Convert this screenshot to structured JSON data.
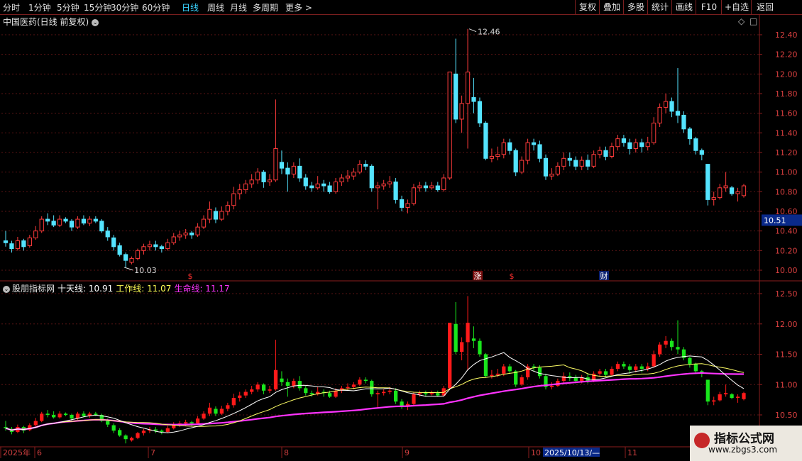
{
  "toolbar": {
    "period_tabs": [
      "分时",
      "1分钟",
      "5分钟",
      "15分钟",
      "30分钟",
      "60分钟",
      "日线",
      "周线",
      "月线",
      "多周期",
      "更多 >"
    ],
    "active_tab": "日线",
    "right_buttons": [
      "复权",
      "叠加",
      "多股",
      "统计",
      "画线",
      "F10",
      "+自选",
      "返回"
    ]
  },
  "main_chart": {
    "title": "中国医药(日线 前复权)",
    "price_ticks": [
      "12.40",
      "12.20",
      "12.00",
      "11.80",
      "11.60",
      "11.40",
      "11.20",
      "11.00",
      "10.80",
      "10.60",
      "10.40",
      "10.20",
      "10.00"
    ],
    "current_price": "10.51",
    "high_label": "12.46",
    "low_label": "10.03",
    "markers": [
      "$",
      "涨",
      "$",
      "财"
    ]
  },
  "sub_chart": {
    "name": "股朋指标网",
    "line1_label": "十天线: 10.91",
    "line2_label": "工作线: 11.07",
    "line3_label": "生命线: 11.17",
    "ticks": [
      "12.50",
      "12.00",
      "11.50",
      "11.00",
      "10.50"
    ]
  },
  "x_axis": {
    "labels": [
      "2025年",
      "6",
      "7",
      "8",
      "9",
      "10",
      "11"
    ],
    "cursor_date": "2025/10/13/—"
  },
  "watermark": {
    "title": "指标公式网",
    "url": "www.zbgs3.com"
  },
  "colors": {
    "up": "#ff3b3b",
    "down": "#54e4ff",
    "sub_up": "#ff1a1a",
    "sub_down": "#19e61c",
    "ma_white": "#ffffff",
    "ma_yellow": "#ffff66",
    "ma_magenta": "#ff33ff"
  },
  "chart_data": {
    "type": "candlestick",
    "title": "中国医药(日线 前复权)",
    "ylim": [
      9.95,
      12.5
    ],
    "x_months": [
      "2025年",
      "6",
      "7",
      "8",
      "9",
      "10",
      "11"
    ],
    "candles": [
      {
        "o": 10.3,
        "c": 10.28,
        "h": 10.4,
        "l": 10.24
      },
      {
        "o": 10.27,
        "c": 10.22,
        "h": 10.3,
        "l": 10.18
      },
      {
        "o": 10.22,
        "c": 10.3,
        "h": 10.34,
        "l": 10.2
      },
      {
        "o": 10.3,
        "c": 10.24,
        "h": 10.32,
        "l": 10.2
      },
      {
        "o": 10.25,
        "c": 10.33,
        "h": 10.36,
        "l": 10.23
      },
      {
        "o": 10.33,
        "c": 10.4,
        "h": 10.45,
        "l": 10.31
      },
      {
        "o": 10.4,
        "c": 10.52,
        "h": 10.55,
        "l": 10.38
      },
      {
        "o": 10.52,
        "c": 10.5,
        "h": 10.58,
        "l": 10.46
      },
      {
        "o": 10.5,
        "c": 10.46,
        "h": 10.56,
        "l": 10.44
      },
      {
        "o": 10.46,
        "c": 10.52,
        "h": 10.56,
        "l": 10.44
      },
      {
        "o": 10.52,
        "c": 10.5,
        "h": 10.54,
        "l": 10.48
      },
      {
        "o": 10.5,
        "c": 10.44,
        "h": 10.52,
        "l": 10.4
      },
      {
        "o": 10.44,
        "c": 10.52,
        "h": 10.55,
        "l": 10.42
      },
      {
        "o": 10.52,
        "c": 10.48,
        "h": 10.56,
        "l": 10.46
      },
      {
        "o": 10.48,
        "c": 10.52,
        "h": 10.55,
        "l": 10.45
      },
      {
        "o": 10.52,
        "c": 10.5,
        "h": 10.55,
        "l": 10.48
      },
      {
        "o": 10.5,
        "c": 10.4,
        "h": 10.52,
        "l": 10.38
      },
      {
        "o": 10.4,
        "c": 10.34,
        "h": 10.44,
        "l": 10.3
      },
      {
        "o": 10.33,
        "c": 10.24,
        "h": 10.36,
        "l": 10.2
      },
      {
        "o": 10.25,
        "c": 10.16,
        "h": 10.28,
        "l": 10.14
      },
      {
        "o": 10.16,
        "c": 10.1,
        "h": 10.18,
        "l": 10.03
      },
      {
        "o": 10.08,
        "c": 10.12,
        "h": 10.14,
        "l": 10.06
      },
      {
        "o": 10.12,
        "c": 10.2,
        "h": 10.22,
        "l": 10.1
      },
      {
        "o": 10.2,
        "c": 10.24,
        "h": 10.27,
        "l": 10.16
      },
      {
        "o": 10.24,
        "c": 10.26,
        "h": 10.3,
        "l": 10.2
      },
      {
        "o": 10.26,
        "c": 10.24,
        "h": 10.3,
        "l": 10.2
      },
      {
        "o": 10.24,
        "c": 10.22,
        "h": 10.26,
        "l": 10.18
      },
      {
        "o": 10.22,
        "c": 10.28,
        "h": 10.32,
        "l": 10.2
      },
      {
        "o": 10.28,
        "c": 10.34,
        "h": 10.38,
        "l": 10.26
      },
      {
        "o": 10.34,
        "c": 10.36,
        "h": 10.4,
        "l": 10.3
      },
      {
        "o": 10.36,
        "c": 10.38,
        "h": 10.42,
        "l": 10.32
      },
      {
        "o": 10.38,
        "c": 10.36,
        "h": 10.4,
        "l": 10.32
      },
      {
        "o": 10.36,
        "c": 10.44,
        "h": 10.48,
        "l": 10.34
      },
      {
        "o": 10.44,
        "c": 10.52,
        "h": 10.56,
        "l": 10.42
      },
      {
        "o": 10.52,
        "c": 10.62,
        "h": 10.7,
        "l": 10.48
      },
      {
        "o": 10.6,
        "c": 10.52,
        "h": 10.64,
        "l": 10.48
      },
      {
        "o": 10.52,
        "c": 10.6,
        "h": 10.65,
        "l": 10.5
      },
      {
        "o": 10.6,
        "c": 10.66,
        "h": 10.7,
        "l": 10.56
      },
      {
        "o": 10.66,
        "c": 10.78,
        "h": 10.85,
        "l": 10.62
      },
      {
        "o": 10.78,
        "c": 10.82,
        "h": 10.88,
        "l": 10.72
      },
      {
        "o": 10.82,
        "c": 10.88,
        "h": 10.92,
        "l": 10.78
      },
      {
        "o": 10.88,
        "c": 10.92,
        "h": 10.98,
        "l": 10.84
      },
      {
        "o": 10.92,
        "c": 11.0,
        "h": 11.04,
        "l": 10.88
      },
      {
        "o": 11.0,
        "c": 10.9,
        "h": 11.02,
        "l": 10.84
      },
      {
        "o": 10.9,
        "c": 10.92,
        "h": 10.98,
        "l": 10.86
      },
      {
        "o": 10.92,
        "c": 11.24,
        "h": 11.74,
        "l": 10.9
      },
      {
        "o": 11.1,
        "c": 11.04,
        "h": 11.22,
        "l": 10.98
      },
      {
        "o": 11.04,
        "c": 10.98,
        "h": 11.1,
        "l": 10.8
      },
      {
        "o": 10.98,
        "c": 11.06,
        "h": 11.1,
        "l": 10.94
      },
      {
        "o": 11.06,
        "c": 10.94,
        "h": 11.14,
        "l": 10.9
      },
      {
        "o": 10.94,
        "c": 10.86,
        "h": 10.98,
        "l": 10.82
      },
      {
        "o": 10.86,
        "c": 10.84,
        "h": 10.9,
        "l": 10.8
      },
      {
        "o": 10.84,
        "c": 10.88,
        "h": 10.96,
        "l": 10.82
      },
      {
        "o": 10.88,
        "c": 10.86,
        "h": 10.92,
        "l": 10.8
      },
      {
        "o": 10.86,
        "c": 10.8,
        "h": 10.9,
        "l": 10.78
      },
      {
        "o": 10.8,
        "c": 10.9,
        "h": 10.94,
        "l": 10.78
      },
      {
        "o": 10.9,
        "c": 10.94,
        "h": 10.98,
        "l": 10.86
      },
      {
        "o": 10.94,
        "c": 10.96,
        "h": 11.02,
        "l": 10.9
      },
      {
        "o": 10.96,
        "c": 11.0,
        "h": 11.04,
        "l": 10.92
      },
      {
        "o": 11.0,
        "c": 11.08,
        "h": 11.12,
        "l": 10.98
      },
      {
        "o": 11.08,
        "c": 11.06,
        "h": 11.12,
        "l": 11.02
      },
      {
        "o": 11.06,
        "c": 10.84,
        "h": 11.08,
        "l": 10.8
      },
      {
        "o": 10.84,
        "c": 10.86,
        "h": 10.9,
        "l": 10.62
      },
      {
        "o": 10.86,
        "c": 10.88,
        "h": 10.92,
        "l": 10.82
      },
      {
        "o": 10.88,
        "c": 10.9,
        "h": 10.96,
        "l": 10.84
      },
      {
        "o": 10.9,
        "c": 10.72,
        "h": 10.94,
        "l": 10.68
      },
      {
        "o": 10.72,
        "c": 10.64,
        "h": 10.76,
        "l": 10.6
      },
      {
        "o": 10.64,
        "c": 10.68,
        "h": 10.72,
        "l": 10.58
      },
      {
        "o": 10.68,
        "c": 10.84,
        "h": 10.88,
        "l": 10.66
      },
      {
        "o": 10.84,
        "c": 10.86,
        "h": 10.9,
        "l": 10.8
      },
      {
        "o": 10.86,
        "c": 10.84,
        "h": 10.9,
        "l": 10.8
      },
      {
        "o": 10.84,
        "c": 10.86,
        "h": 10.9,
        "l": 10.82
      },
      {
        "o": 10.86,
        "c": 10.82,
        "h": 10.9,
        "l": 10.8
      },
      {
        "o": 10.82,
        "c": 10.94,
        "h": 10.98,
        "l": 10.8
      },
      {
        "o": 10.94,
        "c": 12.02,
        "h": 12.02,
        "l": 10.92
      },
      {
        "o": 12.0,
        "c": 11.54,
        "h": 12.36,
        "l": 11.5
      },
      {
        "o": 11.54,
        "c": 11.7,
        "h": 11.78,
        "l": 11.4
      },
      {
        "o": 11.7,
        "c": 12.02,
        "h": 12.46,
        "l": 11.24
      },
      {
        "o": 11.76,
        "c": 11.72,
        "h": 11.96,
        "l": 11.6
      },
      {
        "o": 11.72,
        "c": 11.5,
        "h": 11.76,
        "l": 11.46
      },
      {
        "o": 11.5,
        "c": 11.14,
        "h": 11.52,
        "l": 11.12
      },
      {
        "o": 11.14,
        "c": 11.16,
        "h": 11.24,
        "l": 11.1
      },
      {
        "o": 11.16,
        "c": 11.18,
        "h": 11.26,
        "l": 11.12
      },
      {
        "o": 11.18,
        "c": 11.3,
        "h": 11.34,
        "l": 11.14
      },
      {
        "o": 11.3,
        "c": 11.22,
        "h": 11.34,
        "l": 11.18
      },
      {
        "o": 11.22,
        "c": 11.0,
        "h": 11.24,
        "l": 10.96
      },
      {
        "o": 11.0,
        "c": 11.12,
        "h": 11.16,
        "l": 10.98
      },
      {
        "o": 11.12,
        "c": 11.3,
        "h": 11.34,
        "l": 11.08
      },
      {
        "o": 11.3,
        "c": 11.28,
        "h": 11.34,
        "l": 11.22
      },
      {
        "o": 11.28,
        "c": 11.14,
        "h": 11.32,
        "l": 11.1
      },
      {
        "o": 11.14,
        "c": 10.96,
        "h": 11.18,
        "l": 10.92
      },
      {
        "o": 10.96,
        "c": 10.98,
        "h": 11.04,
        "l": 10.92
      },
      {
        "o": 10.98,
        "c": 11.06,
        "h": 11.1,
        "l": 10.96
      },
      {
        "o": 11.06,
        "c": 11.14,
        "h": 11.2,
        "l": 11.02
      },
      {
        "o": 11.14,
        "c": 11.12,
        "h": 11.2,
        "l": 11.06
      },
      {
        "o": 11.12,
        "c": 11.06,
        "h": 11.16,
        "l": 11.02
      },
      {
        "o": 11.06,
        "c": 11.12,
        "h": 11.16,
        "l": 11.02
      },
      {
        "o": 11.12,
        "c": 11.06,
        "h": 11.18,
        "l": 11.02
      },
      {
        "o": 11.06,
        "c": 11.18,
        "h": 11.22,
        "l": 11.04
      },
      {
        "o": 11.18,
        "c": 11.22,
        "h": 11.26,
        "l": 11.14
      },
      {
        "o": 11.22,
        "c": 11.16,
        "h": 11.26,
        "l": 11.12
      },
      {
        "o": 11.16,
        "c": 11.26,
        "h": 11.3,
        "l": 11.14
      },
      {
        "o": 11.26,
        "c": 11.34,
        "h": 11.38,
        "l": 11.22
      },
      {
        "o": 11.34,
        "c": 11.3,
        "h": 11.38,
        "l": 11.26
      },
      {
        "o": 11.3,
        "c": 11.24,
        "h": 11.34,
        "l": 11.18
      },
      {
        "o": 11.24,
        "c": 11.3,
        "h": 11.34,
        "l": 11.2
      },
      {
        "o": 11.3,
        "c": 11.26,
        "h": 11.34,
        "l": 11.2
      },
      {
        "o": 11.26,
        "c": 11.3,
        "h": 11.36,
        "l": 11.22
      },
      {
        "o": 11.3,
        "c": 11.5,
        "h": 11.56,
        "l": 11.28
      },
      {
        "o": 11.5,
        "c": 11.66,
        "h": 11.7,
        "l": 11.46
      },
      {
        "o": 11.66,
        "c": 11.72,
        "h": 11.8,
        "l": 11.6
      },
      {
        "o": 11.72,
        "c": 11.62,
        "h": 11.76,
        "l": 11.56
      },
      {
        "o": 11.62,
        "c": 11.58,
        "h": 12.06,
        "l": 11.5
      },
      {
        "o": 11.58,
        "c": 11.44,
        "h": 11.62,
        "l": 11.4
      },
      {
        "o": 11.44,
        "c": 11.34,
        "h": 11.46,
        "l": 11.28
      },
      {
        "o": 11.34,
        "c": 11.22,
        "h": 11.36,
        "l": 11.18
      },
      {
        "o": 11.22,
        "c": 11.18,
        "h": 11.24,
        "l": 11.12
      },
      {
        "o": 11.08,
        "c": 10.72,
        "h": 11.08,
        "l": 10.66
      },
      {
        "o": 10.72,
        "c": 10.74,
        "h": 10.8,
        "l": 10.66
      },
      {
        "o": 10.74,
        "c": 10.84,
        "h": 10.88,
        "l": 10.72
      },
      {
        "o": 10.84,
        "c": 10.86,
        "h": 11.0,
        "l": 10.8
      },
      {
        "o": 10.84,
        "c": 10.78,
        "h": 10.86,
        "l": 10.76
      },
      {
        "o": 10.78,
        "c": 10.8,
        "h": 10.84,
        "l": 10.7
      },
      {
        "o": 10.76,
        "c": 10.86,
        "h": 10.88,
        "l": 10.74
      }
    ]
  }
}
